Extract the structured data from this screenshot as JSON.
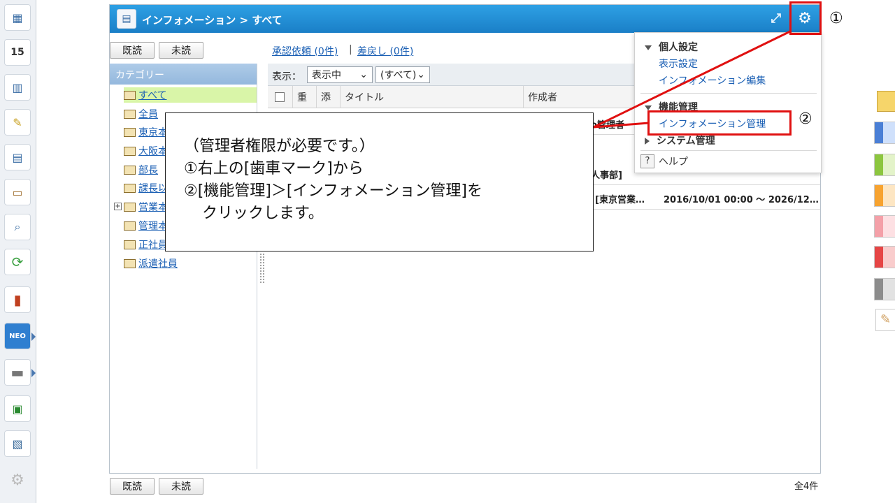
{
  "app": {
    "title": "インフォメーション > すべて"
  },
  "launcher": {
    "items": [
      {
        "icon": "dashboard-icon",
        "glyph": "▦"
      },
      {
        "icon": "calendar-icon",
        "glyph": "15"
      },
      {
        "icon": "chart-icon",
        "glyph": "▥"
      },
      {
        "icon": "memo-icon",
        "glyph": "✎"
      },
      {
        "icon": "board-icon",
        "glyph": "▤"
      },
      {
        "icon": "clipboard-icon",
        "glyph": "▭"
      },
      {
        "icon": "search-doc-icon",
        "glyph": "⌕"
      },
      {
        "icon": "refresh-icon",
        "glyph": "⟳"
      },
      {
        "icon": "binder-icon",
        "glyph": "▮"
      },
      {
        "icon": "neo-icon",
        "glyph": "NEO"
      },
      {
        "icon": "folder-icon",
        "glyph": "▬"
      },
      {
        "icon": "logo-app-icon",
        "glyph": "▣"
      },
      {
        "icon": "photo-app-icon",
        "glyph": "▧"
      },
      {
        "icon": "settings-icon",
        "glyph": "⚙"
      }
    ]
  },
  "toolbar": {
    "read_label": "既読",
    "unread_label": "未読",
    "approval_link": "承認依頼 (0件)",
    "separator": "|",
    "return_link": "差戻し (0件)"
  },
  "sidebar": {
    "header": "カテゴリー",
    "categories": [
      "すべて",
      "全員",
      "東京本",
      "大阪本",
      "部長",
      "課長以",
      "営業本",
      "管理本",
      "正社員",
      "派遣社員"
    ]
  },
  "filter": {
    "display_label": "表示：",
    "display_value": "表示中",
    "scope_value": "(すべて)"
  },
  "table": {
    "columns": [
      "重",
      "添",
      "タイトル",
      "作成者"
    ],
    "rows": [
      {
        "author": "o管理者"
      },
      {
        "author": "人事部]"
      },
      {
        "author": "[東京営業…",
        "period": "2016/10/01 00:00 ～ 2026/12…"
      }
    ]
  },
  "menu": {
    "personal_header": "個人設定",
    "display_settings": "表示設定",
    "info_edit": "インフォメーション編集",
    "function_header": "機能管理",
    "info_manage": "インフォメーション管理",
    "system_header": "システム管理",
    "help_label": "ヘルプ",
    "help_icon_glyph": "?"
  },
  "callout": {
    "line1": "（管理者権限が必要です。）",
    "line2": "①右上の[歯車マーク]から",
    "line3": "②[機能管理]＞[インフォメーション管理]を",
    "line4": "クリックします。"
  },
  "markers": {
    "one": "①",
    "two": "②"
  },
  "footer": {
    "total": "全4件"
  },
  "colors": {
    "titlebar": "#1a8fd6",
    "highlight": "#e01010",
    "selected_category": "#d9f5a8",
    "strip": [
      "#f4c84a",
      "#4a7fd6",
      "#8cc63f",
      "#f7a330",
      "#f4a0a8",
      "#e64545",
      "#8c8c8c",
      "#d0a060"
    ]
  }
}
